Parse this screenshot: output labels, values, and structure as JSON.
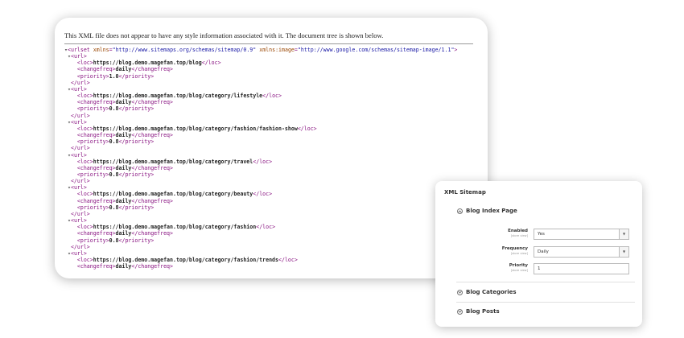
{
  "xml_viewer": {
    "notice": "This XML file does not appear to have any style information associated with it. The document tree is shown below.",
    "root_tag": "urlset",
    "root_attrs": [
      {
        "name": "xmlns",
        "value": "http://www.sitemaps.org/schemas/sitemap/0.9"
      },
      {
        "name": "xmlns:image",
        "value": "http://www.google.com/schemas/sitemap-image/1.1"
      }
    ],
    "urls": [
      {
        "loc": "https://blog.demo.magefan.top/blog",
        "changefreq": "daily",
        "priority": "1.0"
      },
      {
        "loc": "https://blog.demo.magefan.top/blog/category/lifestyle",
        "changefreq": "daily",
        "priority": "0.8"
      },
      {
        "loc": "https://blog.demo.magefan.top/blog/category/fashion/fashion-show",
        "changefreq": "daily",
        "priority": "0.8"
      },
      {
        "loc": "https://blog.demo.magefan.top/blog/category/travel",
        "changefreq": "daily",
        "priority": "0.8"
      },
      {
        "loc": "https://blog.demo.magefan.top/blog/category/beauty",
        "changefreq": "daily",
        "priority": "0.8"
      },
      {
        "loc": "https://blog.demo.magefan.top/blog/category/fashion",
        "changefreq": "daily",
        "priority": "0.8"
      },
      {
        "loc": "https://blog.demo.magefan.top/blog/category/fashion/trends",
        "changefreq": "daily"
      }
    ]
  },
  "config": {
    "title": "XML Sitemap",
    "sections": {
      "index": "Blog Index Page",
      "categories": "Blog Categories",
      "posts": "Blog Posts"
    },
    "scope": "[store view]",
    "fields": {
      "enabled": {
        "label": "Enabled",
        "value": "Yes"
      },
      "frequency": {
        "label": "Frequency",
        "value": "Daily"
      },
      "priority": {
        "label": "Priority",
        "value": "1"
      }
    },
    "arrow": "▼"
  }
}
